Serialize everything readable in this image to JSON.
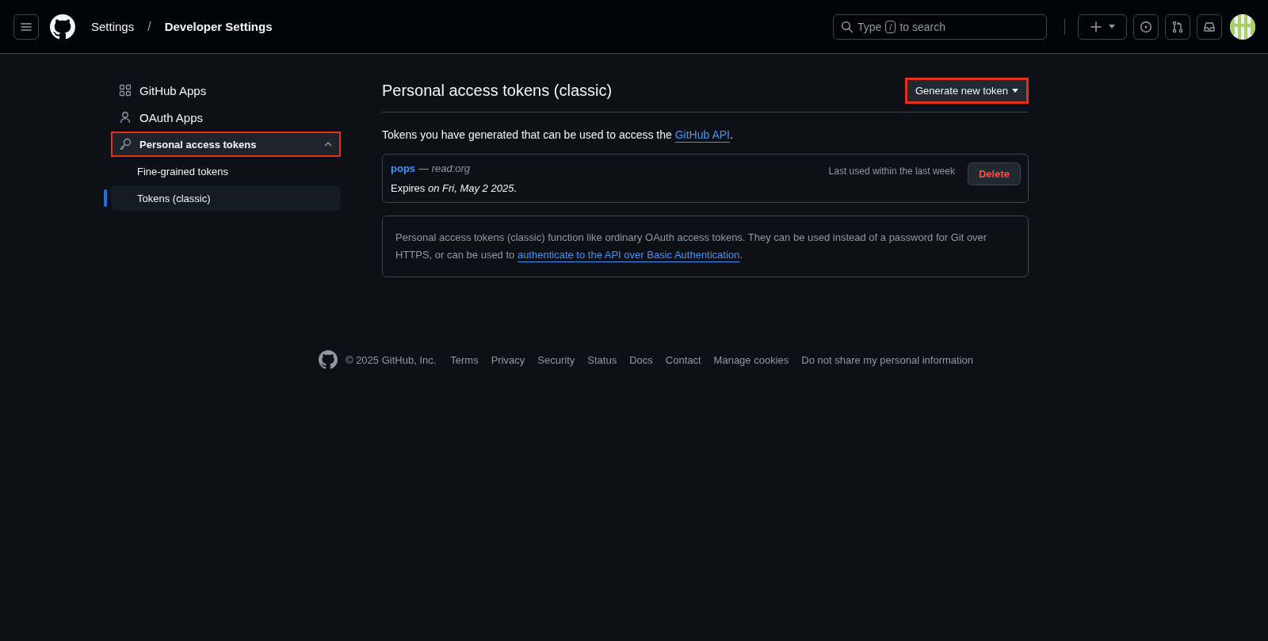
{
  "header": {
    "breadcrumbs": [
      {
        "label": "Settings",
        "current": false
      },
      {
        "label": "Developer Settings",
        "current": true
      }
    ],
    "separator": "/",
    "search": {
      "placeholder_before": "Type",
      "key": "/",
      "placeholder_after": "to search"
    }
  },
  "sidebar": {
    "items": [
      {
        "label": "GitHub Apps",
        "highlighted": false,
        "expanded": false
      },
      {
        "label": "OAuth Apps",
        "highlighted": false,
        "expanded": false
      },
      {
        "label": "Personal access tokens",
        "highlighted": true,
        "expanded": true,
        "children": [
          {
            "label": "Fine-grained tokens",
            "selected": false
          },
          {
            "label": "Tokens (classic)",
            "selected": true
          }
        ]
      }
    ]
  },
  "main": {
    "title": "Personal access tokens (classic)",
    "generate_button": {
      "label": "Generate new token",
      "highlighted": true
    },
    "intro": {
      "before": "Tokens you have generated that can be used to access the ",
      "link": "GitHub API",
      "after": "."
    },
    "tokens": [
      {
        "name": "pops",
        "scope": "— read:org",
        "expires": "Expires *on Fri, May 2 2025*.",
        "last_used": "Last used within the last week",
        "delete_label": "Delete"
      }
    ],
    "info": {
      "before": "Personal access tokens (classic) function like ordinary OAuth access tokens. They can be used instead of a password for Git over HTTPS, or can be used to ",
      "link": "authenticate to the API over Basic Authentication",
      "after": "."
    }
  },
  "footer": {
    "copyright": "© 2025 GitHub, Inc.",
    "links": [
      "Terms",
      "Privacy",
      "Security",
      "Status",
      "Docs",
      "Contact",
      "Manage cookies",
      "Do not share my personal information"
    ]
  }
}
